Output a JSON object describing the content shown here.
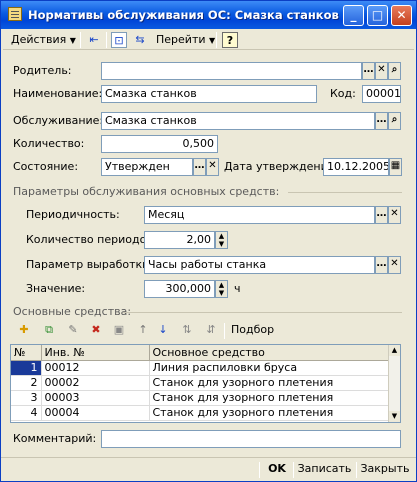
{
  "window": {
    "title": "Нормативы обслуживания ОС: Смазка станков *",
    "controls": {
      "minimize": "_",
      "maximize": "□",
      "close": "✕"
    }
  },
  "toolbar": {
    "actions_label": "Действия",
    "goto_label": "Перейти",
    "help_label": "?"
  },
  "form": {
    "parent_label": "Родитель:",
    "parent_value": "",
    "name_label": "Наименование:",
    "name_value": "Смазка станков",
    "code_label": "Код:",
    "code_value": "00001",
    "service_label": "Обслуживание:",
    "service_value": "Смазка станков",
    "quantity_label": "Количество:",
    "quantity_value": "0,500",
    "state_label": "Состояние:",
    "state_value": "Утвержден",
    "approval_date_label": "Дата утверждения:",
    "approval_date_value": "10.12.2005"
  },
  "params": {
    "section_title": "Параметры обслуживания основных средств:",
    "periodicity_label": "Периодичность:",
    "periodicity_value": "Месяц",
    "periods_count_label": "Количество периодов:",
    "periods_count_value": "2,00",
    "output_param_label": "Параметр выработки:",
    "output_param_value": "Часы работы станка",
    "value_label": "Значение:",
    "value_value": "300,000",
    "value_unit": "ч"
  },
  "assets": {
    "section_title": "Основные средства:",
    "select_label": "Подбор",
    "columns": [
      "№",
      "Инв. №",
      "Основное средство"
    ],
    "rows": [
      {
        "num": "1",
        "inv": "00012",
        "asset": "Линия распиловки бруса"
      },
      {
        "num": "2",
        "inv": "00002",
        "asset": "Станок для узорного плетения"
      },
      {
        "num": "3",
        "inv": "00003",
        "asset": "Станок для узорного плетения"
      },
      {
        "num": "4",
        "inv": "00004",
        "asset": "Станок для узорного плетения"
      }
    ]
  },
  "comment": {
    "label": "Комментарий:",
    "value": ""
  },
  "footer": {
    "ok_label": "OK",
    "save_label": "Записать",
    "close_label": "Закрыть"
  }
}
